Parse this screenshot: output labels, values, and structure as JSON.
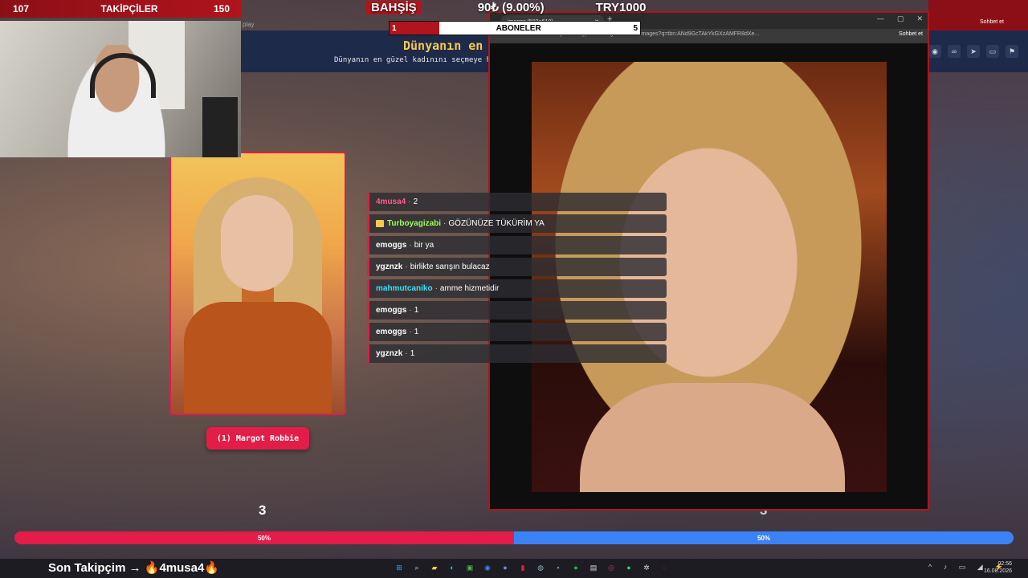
{
  "overlay": {
    "followers": {
      "current": "107",
      "label": "TAKİPÇİLER",
      "goal": "150"
    },
    "tip": {
      "label": "BAHŞİŞ",
      "amount": "90₺ (9.00%)",
      "goal": "TRY1000",
      "progress": 0.09
    },
    "subscribers": {
      "current": "1",
      "label": "ABONELER",
      "goal": "5",
      "progress": 0.2
    },
    "last_follower_label": "Son Takipçim →",
    "last_follower_name": "4musa4"
  },
  "game": {
    "tab_text": "play",
    "title": "Dünyanın en",
    "subtitle": "Dünyanın en güzel kadınını seçmeye hazı",
    "left_choice_label": "(1) Margot Robbie",
    "left_count": "3",
    "right_count": "3",
    "left_percent": "50%",
    "right_percent": "50%",
    "left_share": 0.5,
    "colors": {
      "left": "#e11d48",
      "right": "#3b82f6"
    }
  },
  "browser": {
    "tab_title": "images (503×610)",
    "url": "https://encrypted-tbn0.gstatic.com/images?q=tbn:ANd9GcTAkYkGXzAMFR8dXe...",
    "chat_button": "Sohbet et"
  },
  "chat": [
    {
      "user": "4musa4",
      "text": "2",
      "color": "#ff5a8a",
      "badge": false
    },
    {
      "user": "Turboyagizabi",
      "text": "GÖZÜNÜZE TÜKÜRİM YA",
      "color": "#9cff57",
      "badge": true
    },
    {
      "user": "emoggs",
      "text": "bir ya",
      "color": "#ffffff",
      "badge": false
    },
    {
      "user": "ygznzk",
      "text": "birlikte sarışın bulacaz",
      "color": "#ffffff",
      "badge": false
    },
    {
      "user": "mahmutcaniko",
      "text": "amme hizmetidir",
      "color": "#33e0ff",
      "badge": false
    },
    {
      "user": "emoggs",
      "text": "1",
      "color": "#ffffff",
      "badge": false
    },
    {
      "user": "emoggs",
      "text": "1",
      "color": "#ffffff",
      "badge": false
    },
    {
      "user": "ygznzk",
      "text": "1",
      "color": "#ffffff",
      "badge": false
    }
  ],
  "right_page": {
    "chat_button": "Sohbet et"
  },
  "taskbar": {
    "time": "02:56",
    "date": "16.08.2026"
  }
}
